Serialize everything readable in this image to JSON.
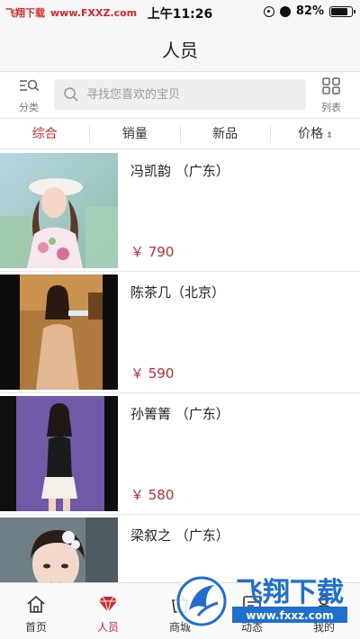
{
  "status_bar": {
    "watermark_brand": "飞翔下载",
    "watermark_url": "www.FXXZ.com",
    "time": "上午11:26",
    "battery": "82%",
    "battery_level": 0.82
  },
  "nav": {
    "title": "人员"
  },
  "toolbar": {
    "category_label": "分类",
    "list_label": "列表"
  },
  "search": {
    "placeholder": "寻找您喜欢的宝贝"
  },
  "sort_tabs": [
    {
      "label": "综合",
      "active": true
    },
    {
      "label": "销量"
    },
    {
      "label": "新品"
    },
    {
      "label": "价格",
      "arrow": "⇕"
    }
  ],
  "items": [
    {
      "name": "冯凯韵 （广东）",
      "price": "￥ 790"
    },
    {
      "name": "陈茶几（北京）",
      "price": "￥ 590"
    },
    {
      "name": "孙箐箐 （广东）",
      "price": "￥ 580"
    },
    {
      "name": "梁叙之 （广东）",
      "price": ""
    }
  ],
  "tab_bar": [
    {
      "label": "首页",
      "icon": "home-icon"
    },
    {
      "label": "人员",
      "icon": "people-icon",
      "active": true
    },
    {
      "label": "商城",
      "icon": "mall-icon"
    },
    {
      "label": "动态",
      "icon": "feed-icon"
    },
    {
      "label": "我的",
      "icon": "user-icon"
    }
  ],
  "watermark_bottom": {
    "brand": "飞翔下载",
    "url": "www.fxxz.com"
  },
  "colors": {
    "accent": "#d6262b",
    "watermark_blue": "#1f6fd0"
  }
}
